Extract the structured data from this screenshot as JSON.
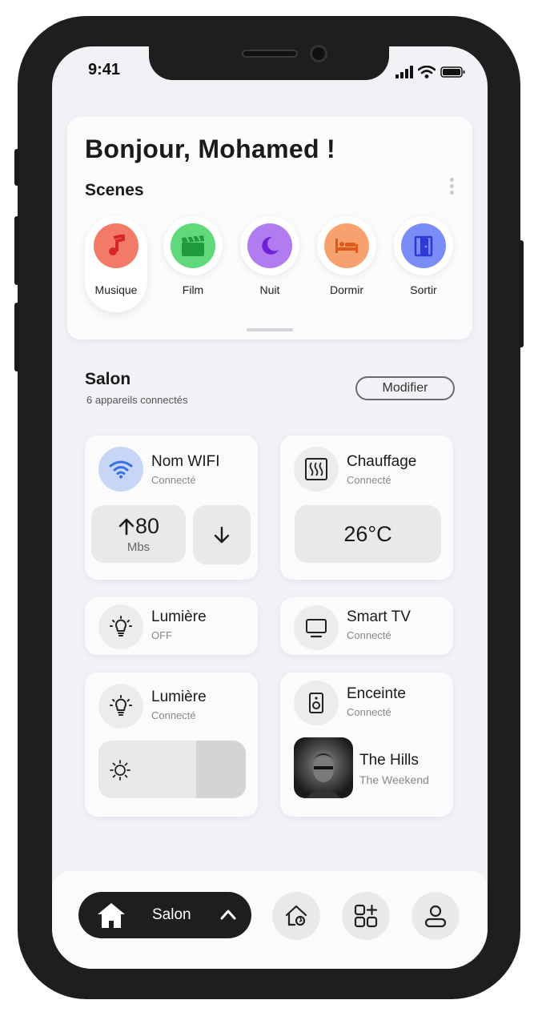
{
  "status_bar": {
    "time": "9:41"
  },
  "header": {
    "greeting": "Bonjour, Mohamed !"
  },
  "scenes": {
    "title": "Scenes",
    "items": [
      {
        "label": "Musique",
        "icon": "music-note-icon",
        "color": "#f47a68"
      },
      {
        "label": "Film",
        "icon": "clapperboard-icon",
        "color": "#5fd97a"
      },
      {
        "label": "Nuit",
        "icon": "moon-icon",
        "color": "#b07cf0"
      },
      {
        "label": "Dormir",
        "icon": "bed-icon",
        "color": "#f7a26e"
      },
      {
        "label": "Sortir",
        "icon": "door-icon",
        "color": "#7a8cf5"
      }
    ]
  },
  "room": {
    "title": "Salon",
    "subtitle": "6 appareils connectés",
    "modify_label": "Modifier"
  },
  "devices": {
    "wifi": {
      "name": "Nom WIFI",
      "status": "Connecté",
      "upload_value": "80",
      "upload_unit": "Mbs"
    },
    "heating": {
      "name": "Chauffage",
      "status": "Connecté",
      "temperature": "26°C"
    },
    "light1": {
      "name": "Lumière",
      "status": "OFF"
    },
    "tv": {
      "name": "Smart TV",
      "status": "Connecté"
    },
    "light2": {
      "name": "Lumière",
      "status": "Connecté"
    },
    "speaker": {
      "name": "Enceinte",
      "status": "Connecté",
      "track": "The Hills",
      "artist": "The Weekend"
    }
  },
  "nav": {
    "current_label": "Salon"
  }
}
